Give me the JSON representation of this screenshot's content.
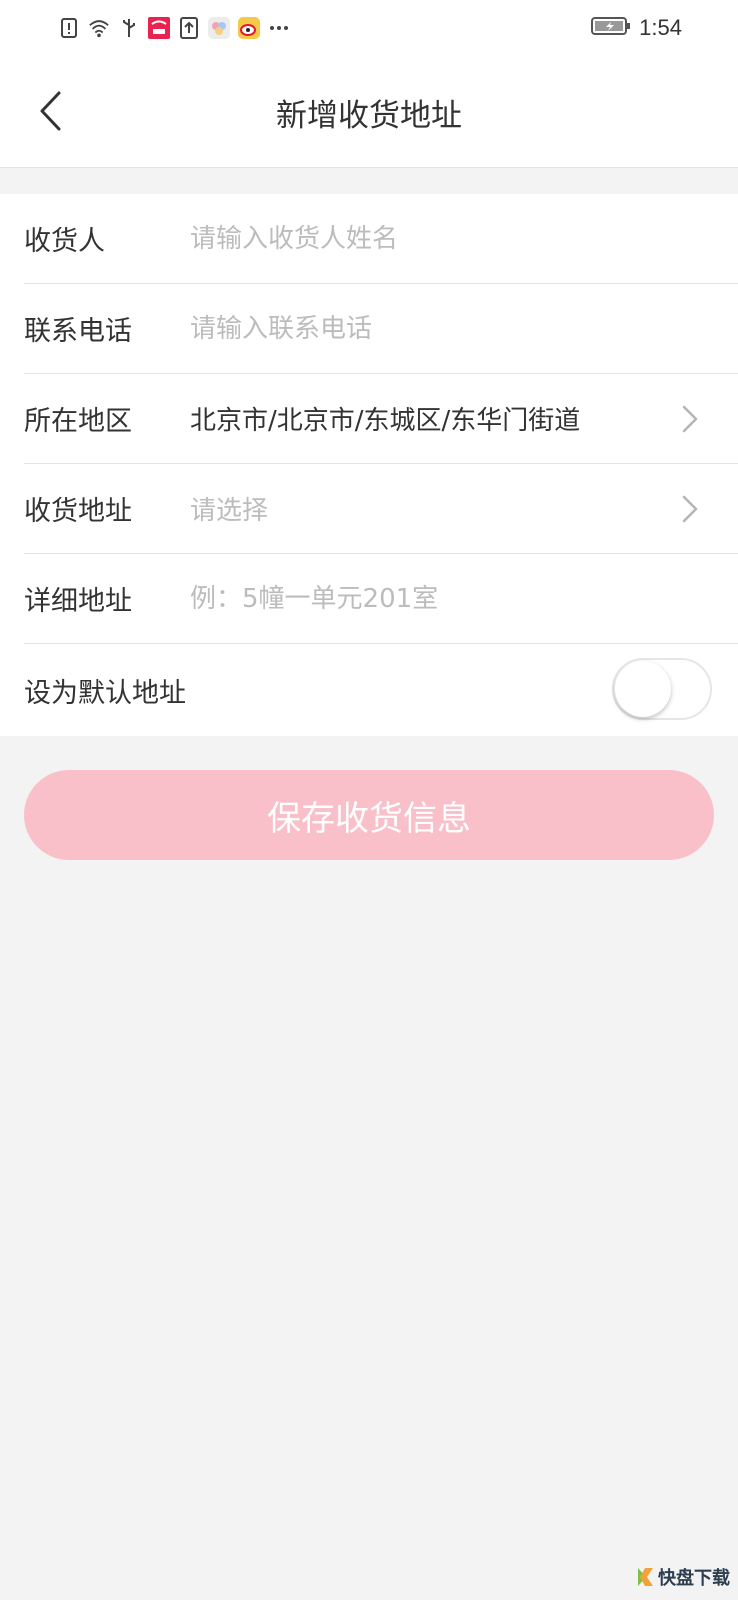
{
  "status_bar": {
    "time": "1:54",
    "icons": [
      "sim-alert-icon",
      "wifi-icon",
      "usb-icon",
      "app-notification-icon",
      "upload-icon",
      "gallery-icon",
      "weibo-icon",
      "more-icon"
    ]
  },
  "header": {
    "title": "新增收货地址"
  },
  "form": {
    "consignee": {
      "label": "收货人",
      "placeholder": "请输入收货人姓名"
    },
    "phone": {
      "label": "联系电话",
      "placeholder": "请输入联系电话"
    },
    "region": {
      "label": "所在地区",
      "value": "北京市/北京市/东城区/东华门街道"
    },
    "address": {
      "label": "收货地址",
      "placeholder": "请选择"
    },
    "detail": {
      "label": "详细地址",
      "placeholder": "例：5幢一单元201室"
    },
    "default": {
      "label": "设为默认地址",
      "enabled": false
    }
  },
  "save_button": {
    "label": "保存收货信息"
  },
  "colors": {
    "accent_pink": "#f9c0ca",
    "background": "#f3f3f3",
    "placeholder": "#bcbcbc"
  },
  "watermark": {
    "text": "快盘下载"
  }
}
